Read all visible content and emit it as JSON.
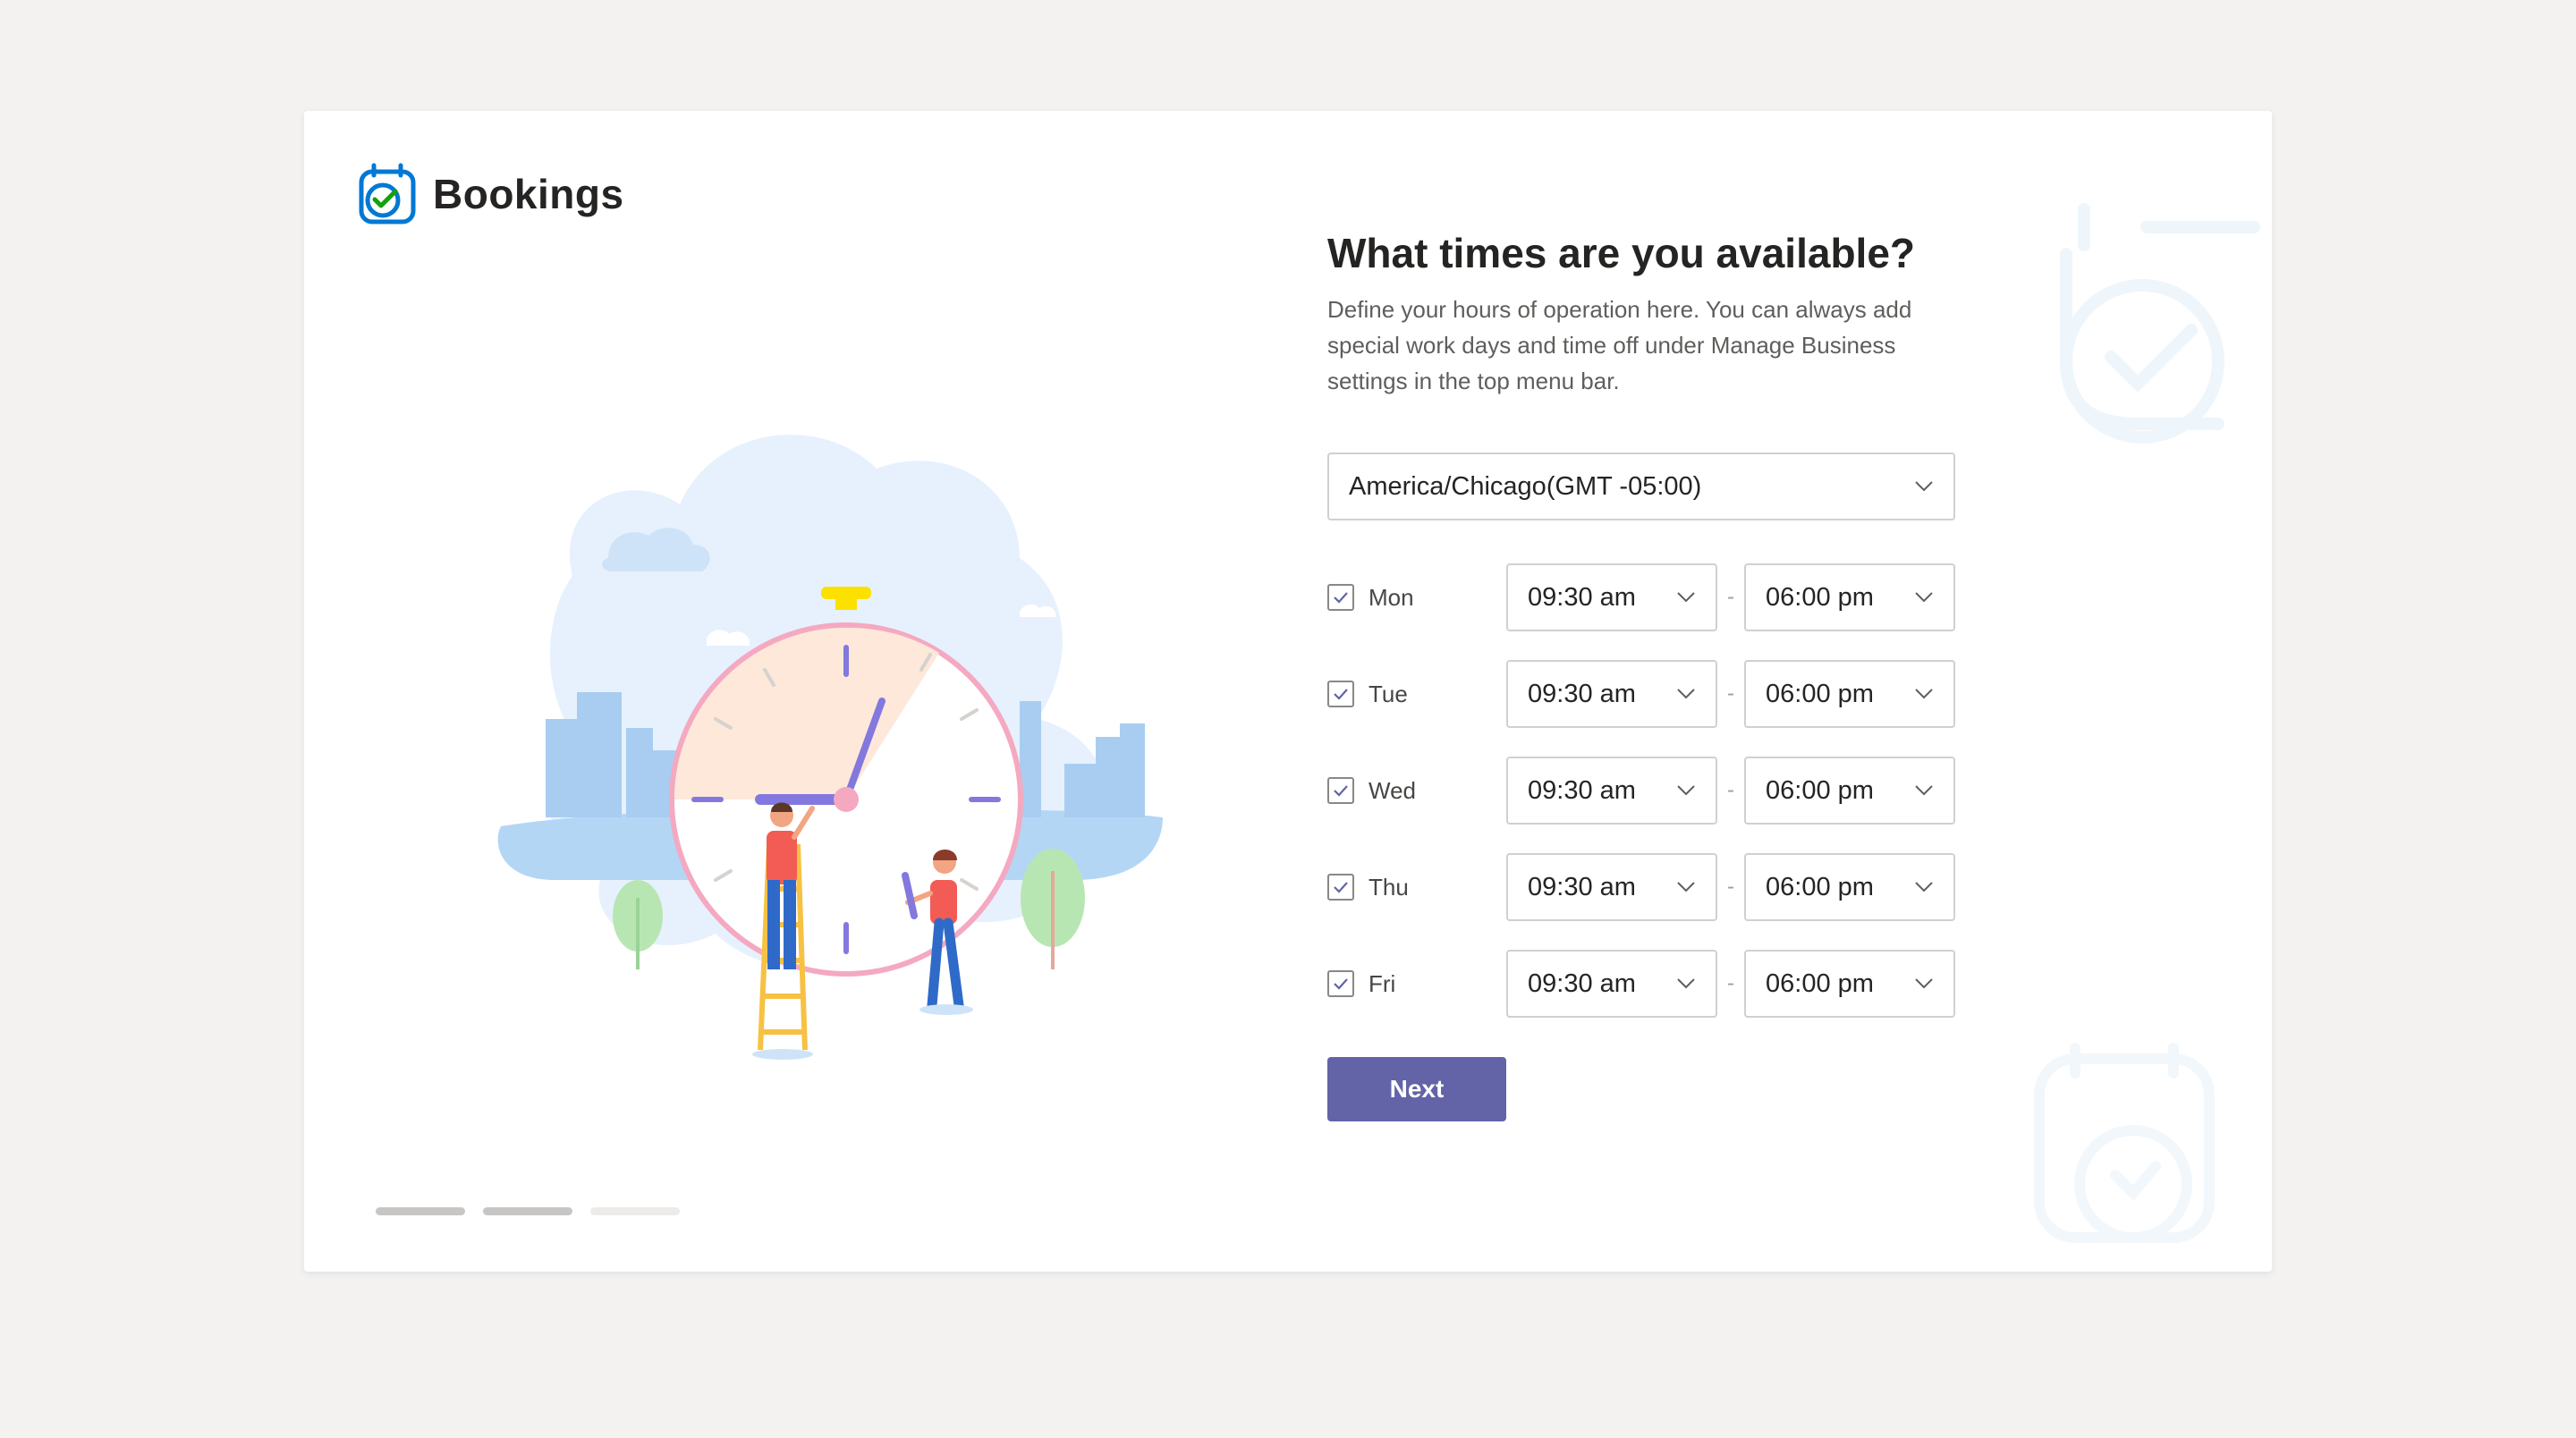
{
  "brand": {
    "name": "Bookings",
    "icon": "bookings-calendar-icon"
  },
  "form": {
    "heading": "What times are you available?",
    "description": "Define your hours of operation here. You can always add special work days and time off under Manage Business settings in the top menu bar.",
    "timezone": {
      "value": "America/Chicago(GMT -05:00)",
      "icon": "chevron-down-icon"
    },
    "separator": "-",
    "days": [
      {
        "label": "Mon",
        "checked": true,
        "start": "09:30 am",
        "end": "06:00 pm"
      },
      {
        "label": "Tue",
        "checked": true,
        "start": "09:30 am",
        "end": "06:00 pm"
      },
      {
        "label": "Wed",
        "checked": true,
        "start": "09:30 am",
        "end": "06:00 pm"
      },
      {
        "label": "Thu",
        "checked": true,
        "start": "09:30 am",
        "end": "06:00 pm"
      },
      {
        "label": "Fri",
        "checked": true,
        "start": "09:30 am",
        "end": "06:00 pm"
      }
    ],
    "next_label": "Next"
  },
  "progress": {
    "total_steps": 3,
    "current_step": 2
  },
  "colors": {
    "accent": "#6264a7",
    "logo_blue": "#0078d4",
    "logo_green": "#13a10e",
    "page_bg": "#f3f2f1"
  }
}
